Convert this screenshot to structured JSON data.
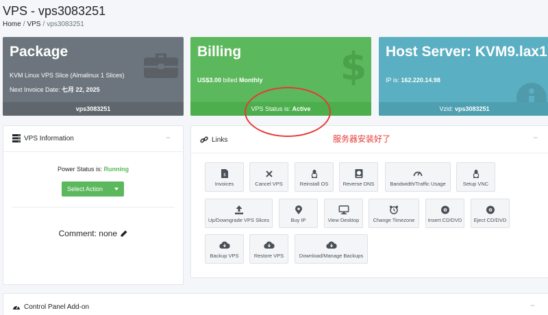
{
  "page": {
    "title": "VPS - vps3083251",
    "breadcrumb": {
      "home": "Home",
      "vps": "VPS",
      "current": "vps3083251",
      "separator": "/"
    }
  },
  "package_card": {
    "title": "Package",
    "description": "KVM Linux VPS Slice (Almalinux 1 Slices)",
    "invoice_label": "Next Invoice Date: ",
    "invoice_date": "七月 22, 2025",
    "footer": "vps3083251",
    "color": "#6c757d",
    "icon": "briefcase-icon"
  },
  "billing_card": {
    "title": "Billing",
    "amount": "US$3.00",
    "billed_text": " billed ",
    "period": "Monthly",
    "status_label": "VPS Status is: ",
    "status_value": "Active",
    "color": "#5cb85c",
    "icon": "dollar-icon"
  },
  "host_card": {
    "title": "Host Server: KVM9.lax1",
    "ip_label": "IP is: ",
    "ip_value": "162.220.14.98",
    "vzid_label": "Vzid: ",
    "vzid_value": "vps3083251",
    "color": "#5bafc2",
    "icon": "info-icon"
  },
  "vps_info": {
    "header": "VPS Information",
    "collapse": "−",
    "power_label": "Power Status is: ",
    "power_value": "Running",
    "select_action": "Select Action",
    "comment": "Comment: none"
  },
  "links": {
    "header": "Links",
    "collapse": "−",
    "tiles": [
      {
        "label": "Invoices",
        "icon": "invoice-icon"
      },
      {
        "label": "Cancel VPS",
        "icon": "close-icon"
      },
      {
        "label": "Reinstall OS",
        "icon": "linux-icon"
      },
      {
        "label": "Reverse DNS",
        "icon": "dns-icon"
      },
      {
        "label": "Bandwidth/Traffic Usage",
        "icon": "gauge-icon"
      },
      {
        "label": "Setup VNC",
        "icon": "linux-icon"
      },
      {
        "label": "Up/Downgrade VPS Slices",
        "icon": "upload-icon"
      },
      {
        "label": "Buy IP",
        "icon": "map-marker-icon"
      },
      {
        "label": "View Desktop",
        "icon": "desktop-icon"
      },
      {
        "label": "Change Timezone",
        "icon": "alarm-clock-icon"
      },
      {
        "label": "Insert CD/DVD",
        "icon": "disc-icon"
      },
      {
        "label": "Eject CD/DVD",
        "icon": "disc-icon"
      },
      {
        "label": "Backup VPS",
        "icon": "cloud-download-icon"
      },
      {
        "label": "Restore VPS",
        "icon": "cloud-download-icon"
      },
      {
        "label": "Download/Manage Backups",
        "icon": "cloud-download-icon"
      }
    ]
  },
  "annotation": {
    "text": "服务器安装好了",
    "color": "#e53935"
  },
  "control_panel": {
    "header": "Control Panel Add-on",
    "collapse": "−"
  }
}
